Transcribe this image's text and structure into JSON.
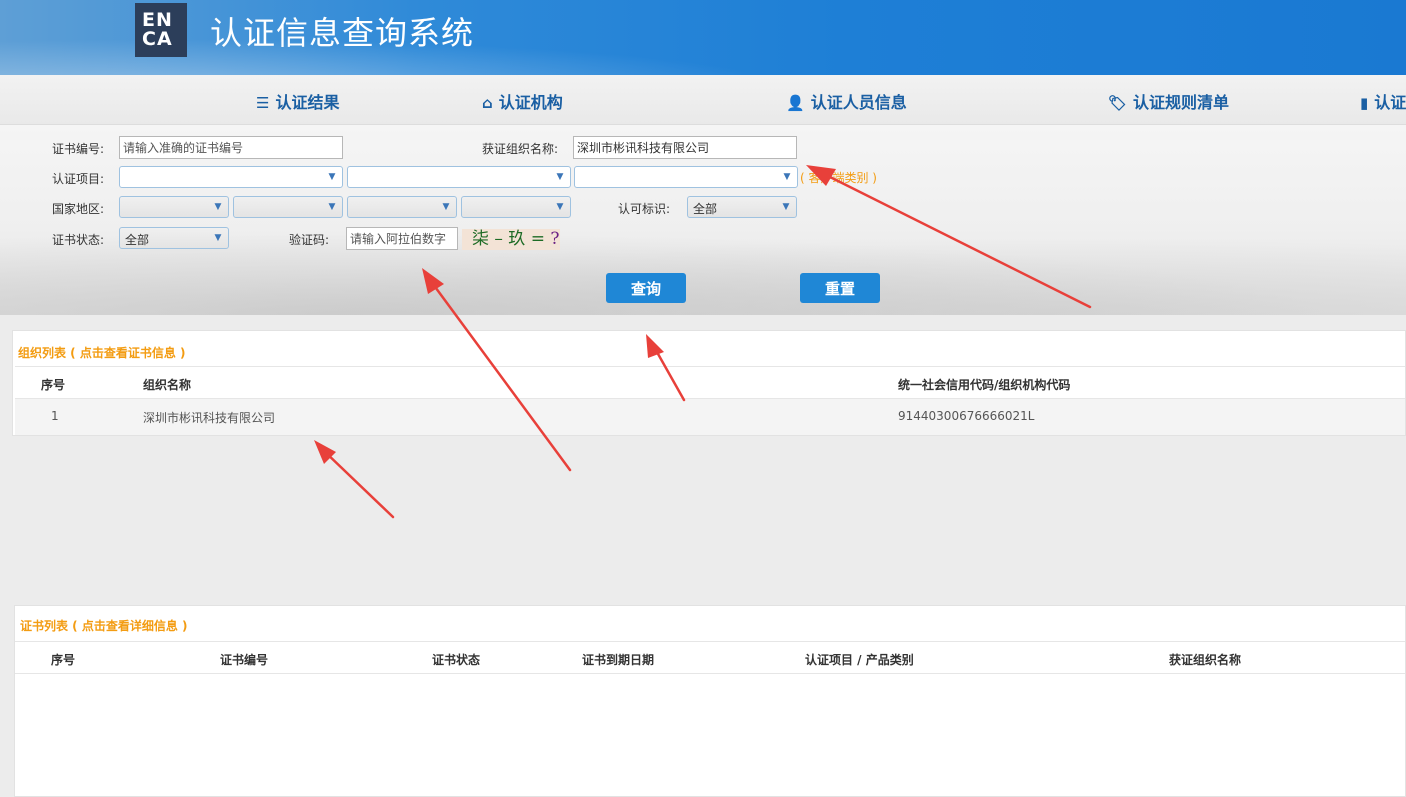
{
  "header": {
    "logo_line1": "EN",
    "logo_line2": "CA",
    "title": "认证信息查询系统"
  },
  "nav": [
    {
      "icon": "list-icon",
      "glyph": "☰",
      "label": "认证结果"
    },
    {
      "icon": "home-icon",
      "glyph": "⌂",
      "label": "认证机构"
    },
    {
      "icon": "user-icon",
      "glyph": "👤",
      "label": "认证人员信息"
    },
    {
      "icon": "tag-icon",
      "glyph": "🏷",
      "label": "认证规则清单"
    },
    {
      "icon": "bar-chart-icon",
      "glyph": "▮",
      "label": "认证"
    }
  ],
  "search": {
    "cert_no_label": "证书编号:",
    "cert_no_placeholder": "请输入准确的证书编号",
    "org_name_label": "获证组织名称:",
    "org_name_value": "深圳市彬讯科技有限公司",
    "project_label": "认证项目:",
    "project_hint": "( 客户端类别 )",
    "region_label": "国家地区:",
    "mark_label": "认可标识:",
    "mark_value": "全部",
    "status_label": "证书状态:",
    "status_value": "全部",
    "captcha_label": "验证码:",
    "captcha_placeholder": "请输入阿拉伯数字",
    "captcha_text": "柒 – 玖 =",
    "captcha_q": " ?",
    "query_button": "查询",
    "reset_button": "重置"
  },
  "org_list": {
    "title": "组织列表 ( 点击查看证书信息 )",
    "columns": [
      "序号",
      "组织名称",
      "统一社会信用代码/组织机构代码"
    ],
    "rows": [
      {
        "index": "1",
        "name": "深圳市彬讯科技有限公司",
        "code": "91440300676666021L"
      }
    ]
  },
  "cert_list": {
    "title": "证书列表 ( 点击查看详细信息 )",
    "columns": [
      "序号",
      "证书编号",
      "证书状态",
      "证书到期日期",
      "认证项目 / 产品类别",
      "获证组织名称"
    ]
  },
  "colors": {
    "accent": "#1f87d6",
    "nav_text": "#1a5fa3",
    "list_title": "#f39c12",
    "annotation_arrow": "#e8403a"
  }
}
